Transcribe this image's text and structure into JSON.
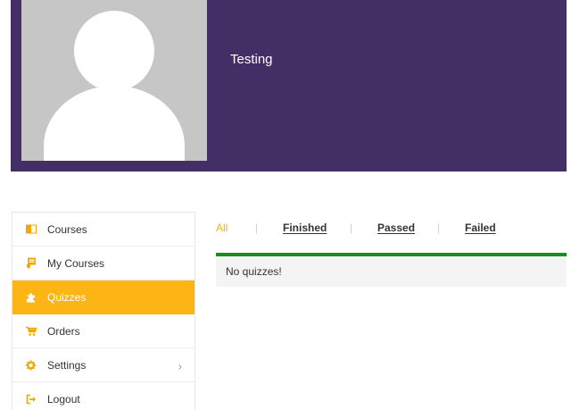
{
  "profile": {
    "name": "Testing"
  },
  "sidebar": {
    "items": [
      {
        "label": "Courses",
        "icon": "book-open-icon"
      },
      {
        "label": "My Courses",
        "icon": "certificate-icon"
      },
      {
        "label": "Quizzes",
        "icon": "puzzle-piece-icon",
        "active": true
      },
      {
        "label": "Orders",
        "icon": "shopping-cart-icon"
      },
      {
        "label": "Settings",
        "icon": "gear-icon"
      },
      {
        "label": "Logout",
        "icon": "sign-out-icon"
      }
    ]
  },
  "tabs": [
    {
      "label": "All",
      "active": true
    },
    {
      "label": "Finished"
    },
    {
      "label": "Passed"
    },
    {
      "label": "Failed"
    }
  ],
  "quizzes": {
    "empty_message": "No quizzes!"
  },
  "colors": {
    "header_bg": "#442e66",
    "accent": "#fdb515",
    "success_bar": "#1b8d1b",
    "panel_bg": "#f4f4f4"
  }
}
